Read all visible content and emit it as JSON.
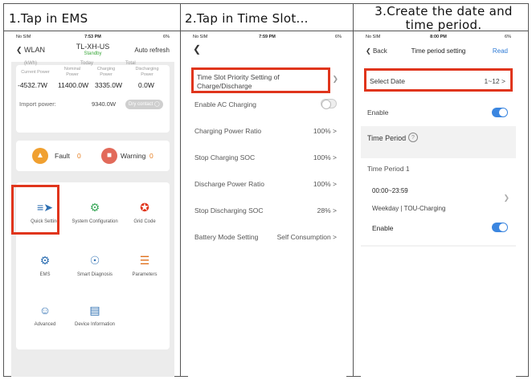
{
  "steps": [
    {
      "title": "1.Tap in EMS"
    },
    {
      "title": "2.Tap in Time Slot..."
    },
    {
      "title": "3.Create the date and time period."
    }
  ],
  "phone1": {
    "status": {
      "carrier": "No SIM",
      "time": "7:53 PM",
      "battery": "6%"
    },
    "nav": {
      "back": "WLAN",
      "title": "TL-XH-US",
      "subtitle": "Standby",
      "refresh": "Auto refresh"
    },
    "peek": [
      "(kWh)",
      "Today",
      "Total"
    ],
    "stats": [
      {
        "label": "Current Power",
        "value": "-4532.7W"
      },
      {
        "label": "Nominal Power",
        "value": "11400.0W"
      },
      {
        "label": "Charging Power",
        "value": "3335.0W"
      },
      {
        "label": "Discharging Power",
        "value": "0.0W"
      }
    ],
    "import_power": {
      "label": "Import power:",
      "value": "9340.0W",
      "button": "Dry contact"
    },
    "alarms": [
      {
        "label": "Fault",
        "count": "0",
        "color": "#f0a030"
      },
      {
        "label": "Warning",
        "count": "0",
        "color": "#e26a5a"
      }
    ],
    "tiles": [
      {
        "label": "Quick Setting",
        "icon": "sliders-icon"
      },
      {
        "label": "System Configuration",
        "icon": "gear-icon"
      },
      {
        "label": "Grid Code",
        "icon": "medal-icon"
      },
      {
        "label": "EMS",
        "icon": "cogs-icon"
      },
      {
        "label": "Smart Diagnosis",
        "icon": "diagnosis-icon"
      },
      {
        "label": "Parameters",
        "icon": "parameters-icon"
      },
      {
        "label": "Advanced",
        "icon": "user-key-icon"
      },
      {
        "label": "Device Information",
        "icon": "server-icon"
      }
    ]
  },
  "phone2": {
    "status": {
      "carrier": "No SIM",
      "time": "7:59 PM",
      "battery": "6%"
    },
    "time_slot": "Time Slot Priority Setting of Charge/Discharge",
    "rows": [
      {
        "label": "Enable AC Charging",
        "value": ""
      },
      {
        "label": "Charging Power Ratio",
        "value": "100% >"
      },
      {
        "label": "Stop Charging SOC",
        "value": "100% >"
      },
      {
        "label": "Discharge Power Ratio",
        "value": "100% >"
      },
      {
        "label": "Stop Discharging SOC",
        "value": "28% >"
      },
      {
        "label": "Battery Mode Setting",
        "value": "Self Consumption >"
      }
    ]
  },
  "phone3": {
    "status": {
      "carrier": "No SIM",
      "time": "8:00 PM",
      "battery": "6%"
    },
    "nav": {
      "back": "Back",
      "title": "Time period setting",
      "read": "Read"
    },
    "select_date": {
      "label": "Select Date",
      "value": "1~12 >"
    },
    "enable": "Enable",
    "time_period_header": "Time Period",
    "time_period_1": "Time Period 1",
    "range": "00:00~23:59",
    "mode": "Weekday | TOU-Charging",
    "enable2": "Enable"
  },
  "colors": {
    "highlight": "#e0351c",
    "toggle_on": "#3b86e0",
    "standby": "#3aa83a"
  }
}
